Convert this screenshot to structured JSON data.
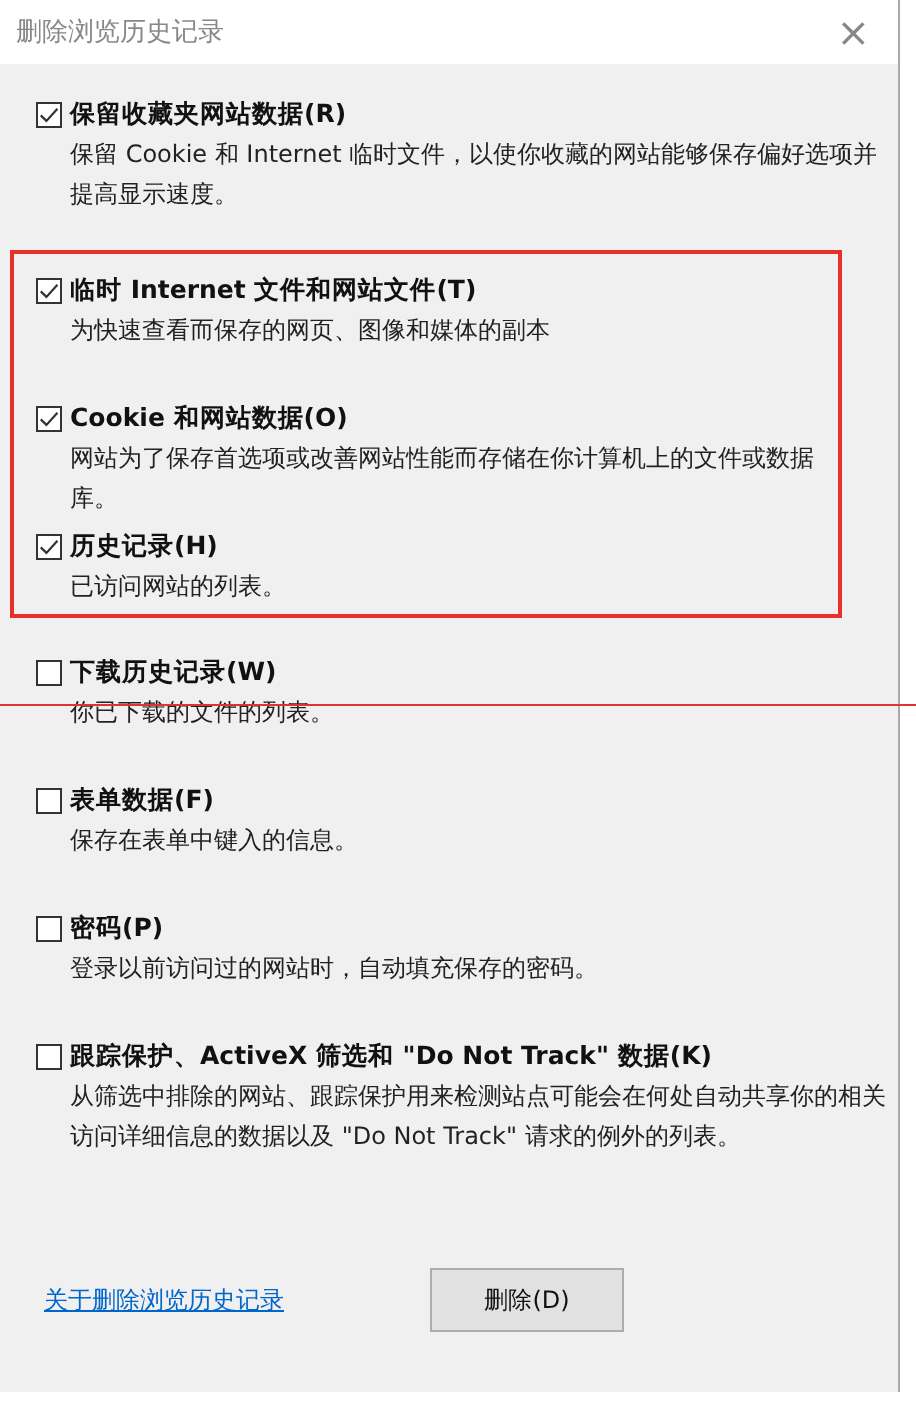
{
  "window": {
    "title": "删除浏览历史记录",
    "close": "×"
  },
  "options": [
    {
      "label": "保留收藏夹网站数据(R)",
      "description": "保留 Cookie 和 Internet 临时文件，以使你收藏的网站能够保存偏好选项并提高显示速度。",
      "checked": true,
      "highlighted": false
    },
    {
      "label": "临时 Internet 文件和网站文件(T)",
      "description": "为快速查看而保存的网页、图像和媒体的副本",
      "checked": true,
      "highlighted": true
    },
    {
      "label": "Cookie 和网站数据(O)",
      "description": "网站为了保存首选项或改善网站性能而存储在你计算机上的文件或数据库。",
      "checked": true,
      "highlighted": true
    },
    {
      "label": "历史记录(H)",
      "description": "已访问网站的列表。",
      "checked": true,
      "highlighted": true
    },
    {
      "label": "下载历史记录(W)",
      "description": "你已下载的文件的列表。",
      "checked": false,
      "highlighted": false
    },
    {
      "label": "表单数据(F)",
      "description": "保存在表单中键入的信息。",
      "checked": false,
      "highlighted": false
    },
    {
      "label": "密码(P)",
      "description": "登录以前访问过的网站时，自动填充保存的密码。",
      "checked": false,
      "highlighted": false
    },
    {
      "label": "跟踪保护、ActiveX 筛选和 \"Do Not Track\" 数据(K)",
      "description": "从筛选中排除的网站、跟踪保护用来检测站点可能会在何处自动共享你的相关访问详细信息的数据以及 \"Do Not Track\" 请求的例外的列表。",
      "checked": false,
      "highlighted": false
    }
  ],
  "footer": {
    "link": "关于删除浏览历史记录",
    "button": "删除(D)"
  }
}
